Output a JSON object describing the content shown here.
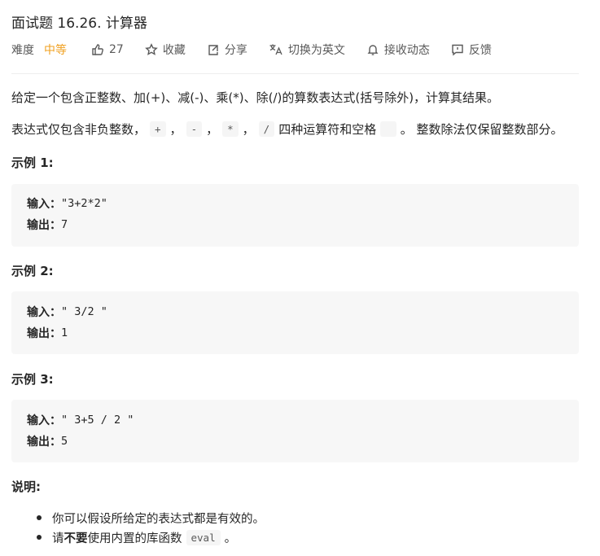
{
  "problem": {
    "title": "面试题 16.26. 计算器",
    "difficulty_label": "难度",
    "difficulty_value": "中等",
    "likes": "27",
    "favorite_label": "收藏",
    "share_label": "分享",
    "switch_lang_label": "切换为英文",
    "follow_label": "接收动态",
    "feedback_label": "反馈",
    "colors": {
      "difficulty": "#f0a020",
      "code_bg": "#f7f7f7",
      "text": "#262626"
    }
  },
  "description": {
    "line1": "给定一个包含正整数、加(+)、减(-)、乘(*)、除(/)的算数表达式(括号除外)，计算其结果。",
    "line2_prefix": "表达式仅包含非负整数，",
    "op_plus": "+",
    "sep1": "，",
    "op_minus": "-",
    "sep2": "，",
    "op_mul": "*",
    "sep3": "，",
    "op_div": "/",
    "line2_middle": "四种运算符和空格",
    "space_code": " ",
    "line2_suffix": "。 整数除法仅保留整数部分。"
  },
  "examples": [
    {
      "heading": "示例 1:",
      "input_label": "输入：",
      "input": "\"3+2*2\"",
      "output_label": "输出：",
      "output": "7"
    },
    {
      "heading": "示例 2:",
      "input_label": "输入：",
      "input": "\" 3/2 \"",
      "output_label": "输出：",
      "output": "1"
    },
    {
      "heading": "示例 3:",
      "input_label": "输入：",
      "input": "\" 3+5 / 2 \"",
      "output_label": "输出：",
      "output": "5"
    }
  ],
  "notes": {
    "heading": "说明:",
    "item1": "你可以假设所给定的表达式都是有效的。",
    "item2_prefix": "请",
    "item2_bold": "不要",
    "item2_middle": "使用内置的库函数",
    "item2_code": "eval",
    "item2_suffix": "。"
  }
}
